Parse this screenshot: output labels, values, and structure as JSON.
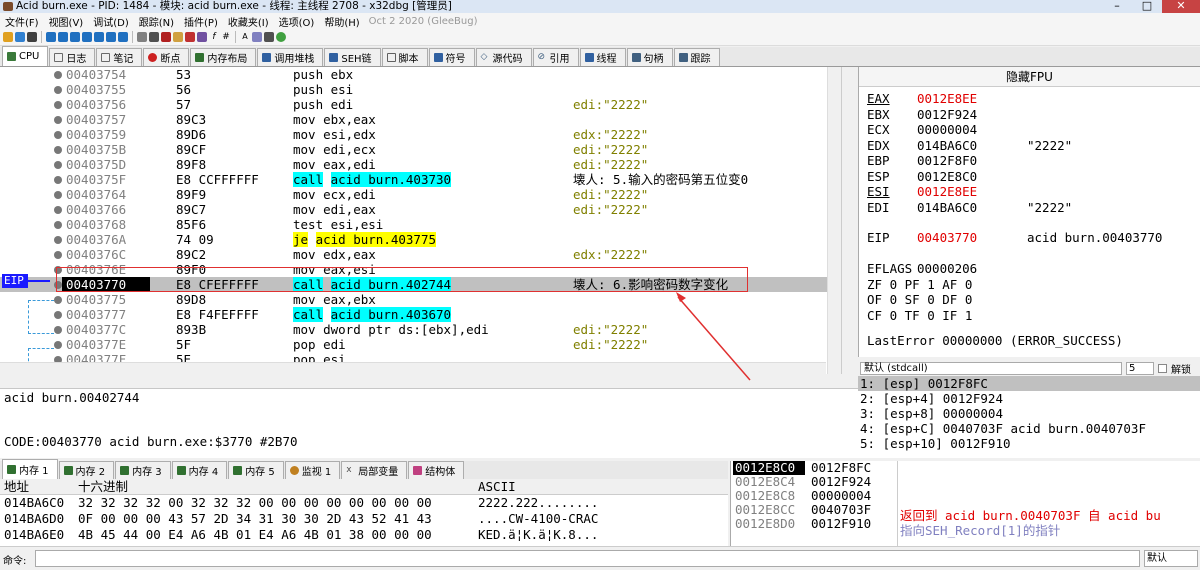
{
  "window": {
    "title": "Acid burn.exe - PID: 1484 - 模块: acid burn.exe - 线程: 主线程 2708 - x32dbg [管理员]"
  },
  "menu": [
    "文件(F)",
    "视图(V)",
    "调试(D)",
    "跟踪(N)",
    "插件(P)",
    "收藏夹(I)",
    "选项(O)",
    "帮助(H)"
  ],
  "menu_about": "Oct 2 2020 (GleeBug)",
  "tabs": [
    {
      "label": "CPU",
      "color": "#3a7a3a"
    },
    {
      "label": "日志",
      "color": "#6a6a6a"
    },
    {
      "label": "笔记",
      "color": "#6a6a6a"
    },
    {
      "label": "断点",
      "color": "#cc2020"
    },
    {
      "label": "内存布局",
      "color": "#307030"
    },
    {
      "label": "调用堆栈",
      "color": "#3060a0"
    },
    {
      "label": "SEH链",
      "color": "#3060a0"
    },
    {
      "label": "脚本",
      "color": "#606060"
    },
    {
      "label": "符号",
      "color": "#3060a0"
    },
    {
      "label": "源代码",
      "color": "#406080"
    },
    {
      "label": "引用",
      "color": "#406080"
    },
    {
      "label": "线程",
      "color": "#3060a0"
    },
    {
      "label": "句柄",
      "color": "#406080"
    },
    {
      "label": "跟踪",
      "color": "#406080"
    }
  ],
  "disasm": [
    {
      "addr": "00403754",
      "bytes": "53",
      "instr": "push ebx",
      "cmt": ""
    },
    {
      "addr": "00403755",
      "bytes": "56",
      "instr": "push esi",
      "cmt": ""
    },
    {
      "addr": "00403756",
      "bytes": "57",
      "instr": "push edi",
      "cmt": "edi:\"2222\""
    },
    {
      "addr": "00403757",
      "bytes": "89C3",
      "instr": "mov ebx,eax",
      "cmt": ""
    },
    {
      "addr": "00403759",
      "bytes": "89D6",
      "instr": "mov esi,edx",
      "cmt": "edx:\"2222\""
    },
    {
      "addr": "0040375B",
      "bytes": "89CF",
      "instr": "mov edi,ecx",
      "cmt": "edi:\"2222\""
    },
    {
      "addr": "0040375D",
      "bytes": "89F8",
      "instr": "mov eax,edi",
      "cmt": "edi:\"2222\""
    },
    {
      "addr": "0040375F",
      "bytes": "E8 CCFFFFFF",
      "instr": "call acid burn.403730",
      "cmt": "壊人: 5.输入的密码第五位变0"
    },
    {
      "addr": "00403764",
      "bytes": "89F9",
      "instr": "mov ecx,edi",
      "cmt": "edi:\"2222\""
    },
    {
      "addr": "00403766",
      "bytes": "89C7",
      "instr": "mov edi,eax",
      "cmt": "edi:\"2222\""
    },
    {
      "addr": "00403768",
      "bytes": "85F6",
      "instr": "test esi,esi",
      "cmt": ""
    },
    {
      "addr": "0040376A",
      "bytes": "74 09",
      "instr": "je acid burn.403775",
      "cmt": ""
    },
    {
      "addr": "0040376C",
      "bytes": "89C2",
      "instr": "mov edx,eax",
      "cmt": "edx:\"2222\""
    },
    {
      "addr": "0040376E",
      "bytes": "89F0",
      "instr": "mov eax,esi",
      "cmt": ""
    },
    {
      "addr": "00403770",
      "bytes": "E8 CFEFFFFF",
      "instr": "call acid burn.402744",
      "cmt": "壊人: 6.影响密码数字变化"
    },
    {
      "addr": "00403775",
      "bytes": "89D8",
      "instr": "mov eax,ebx",
      "cmt": ""
    },
    {
      "addr": "00403777",
      "bytes": "E8 F4FEFFFF",
      "instr": "call acid burn.403670",
      "cmt": ""
    },
    {
      "addr": "0040377C",
      "bytes": "893B",
      "instr": "mov dword ptr ds:[ebx],edi",
      "cmt": "edi:\"2222\""
    },
    {
      "addr": "0040377E",
      "bytes": "5F",
      "instr": "pop edi",
      "cmt": "edi:\"2222\""
    },
    {
      "addr": "0040377F",
      "bytes": "5E",
      "instr": "pop esi",
      "cmt": ""
    },
    {
      "addr": "00403780",
      "bytes": "5B",
      "instr": "pop ebx",
      "cmt": ""
    }
  ],
  "eip_label": "EIP",
  "info": {
    "line1": "acid burn.00402744",
    "line2": "CODE:00403770 acid burn.exe:$3770 #2B70"
  },
  "regs": {
    "header": "隐藏FPU",
    "list": [
      {
        "n": "EAX",
        "v": "0012E8EE",
        "x": "",
        "red": true
      },
      {
        "n": "EBX",
        "v": "0012F924",
        "x": "",
        "red": false
      },
      {
        "n": "ECX",
        "v": "00000004",
        "x": "",
        "red": false
      },
      {
        "n": "EDX",
        "v": "014BA6C0",
        "x": "\"2222\"",
        "red": false
      },
      {
        "n": "EBP",
        "v": "0012F8F0",
        "x": "",
        "red": false
      },
      {
        "n": "ESP",
        "v": "0012E8C0",
        "x": "",
        "red": false
      },
      {
        "n": "ESI",
        "v": "0012E8EE",
        "x": "",
        "red": true
      },
      {
        "n": "EDI",
        "v": "014BA6C0",
        "x": "\"2222\"",
        "red": false
      }
    ],
    "eip": {
      "n": "EIP",
      "v": "00403770",
      "x": "acid burn.00403770"
    },
    "eflags": {
      "n": "EFLAGS",
      "v": "00000206"
    },
    "flags": [
      "ZF 0  PF 1  AF 0",
      "OF 0  SF 0  DF 0",
      "CF 0  TF 0  IF 1"
    ],
    "lasterror": "LastError  00000000 (ERROR_SUCCESS)"
  },
  "callconv": {
    "label": "默认 (stdcall)",
    "count": "5",
    "unlock": "解锁"
  },
  "callargs": [
    "1: [esp] 0012F8FC",
    "2: [esp+4] 0012F924",
    "3: [esp+8] 00000004",
    "4: [esp+C] 0040703F acid burn.0040703F",
    "5: [esp+10] 0012F910"
  ],
  "bottom_tabs": [
    "内存 1",
    "内存 2",
    "内存 3",
    "内存 4",
    "内存 5",
    "监视 1",
    "局部变量",
    "结构体"
  ],
  "memdump": {
    "headers": {
      "addr": "地址",
      "hex": "十六进制",
      "ascii": "ASCII"
    },
    "rows": [
      {
        "addr": "014BA6C0",
        "hex": "32 32 32 32 00 32 32 32 00 00 00 00 00 00 00 00",
        "ascii": "2222.222........"
      },
      {
        "addr": "014BA6D0",
        "hex": "0F 00 00 00 43 57 2D 34 31 30 30 2D 43 52 41 43",
        "ascii": "....CW-4100-CRAC"
      },
      {
        "addr": "014BA6E0",
        "hex": "4B 45 44 00 E4 A6 4B 01 E4 A6 4B 01 38 00 00 00",
        "ascii": "KED.ä¦K.ä¦K.8..."
      }
    ]
  },
  "stack": [
    {
      "a": "0012E8C0",
      "v": "0012F8FC"
    },
    {
      "a": "0012E8C4",
      "v": "0012F924"
    },
    {
      "a": "0012E8C8",
      "v": "00000004"
    },
    {
      "a": "0012E8CC",
      "v": "0040703F"
    },
    {
      "a": "0012E8D0",
      "v": "0012F910"
    }
  ],
  "stack_comment": "返回到 acid burn.0040703F 自 acid bu",
  "stack_comment2": "指向SEH_Record[1]的指针",
  "cmd": {
    "label": "命令:",
    "default": "默认"
  }
}
